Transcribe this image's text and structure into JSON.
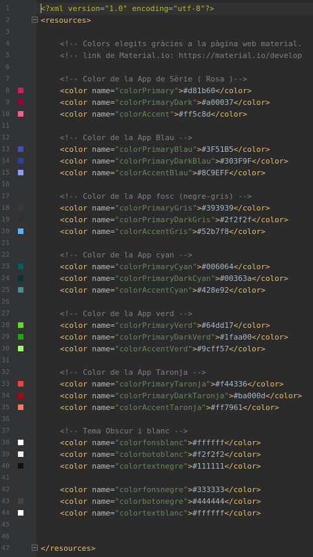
{
  "editor": {
    "lines": [
      {
        "n": "1",
        "kind": "pi",
        "text": "<?xml version=\"1.0\" encoding=\"utf-8\"?>"
      },
      {
        "n": "2",
        "kind": "open",
        "text": "<resources>"
      },
      {
        "n": "3",
        "kind": "blank",
        "text": ""
      },
      {
        "n": "4",
        "kind": "comment",
        "text": "<!-- Colors elegits gràcies a la pàgina web material."
      },
      {
        "n": "5",
        "kind": "comment",
        "text": "<!-- link de Material.io: https://material.io/develop"
      },
      {
        "n": "6",
        "kind": "blank",
        "text": ""
      },
      {
        "n": "7",
        "kind": "comment",
        "text": "<!-- Color de la App de Sèrie ( Rosa )-->"
      },
      {
        "n": "8",
        "kind": "color",
        "name": "colorPrimary",
        "value": "#d81b60",
        "swatch": "#d81b60"
      },
      {
        "n": "9",
        "kind": "color",
        "name": "colorPrimaryDark",
        "value": "#a00037",
        "swatch": "#a00037"
      },
      {
        "n": "10",
        "kind": "color",
        "name": "colorAccent",
        "value": "#ff5c8d",
        "swatch": "#ff5c8d"
      },
      {
        "n": "11",
        "kind": "blank",
        "text": ""
      },
      {
        "n": "12",
        "kind": "comment",
        "text": "<!-- Color de la App Blau -->"
      },
      {
        "n": "13",
        "kind": "color",
        "name": "colorPrimaryBlau",
        "value": "#3F51B5",
        "swatch": "#3F51B5"
      },
      {
        "n": "14",
        "kind": "color",
        "name": "colorPrimaryDarkBlau",
        "value": "#303F9F",
        "swatch": "#303F9F"
      },
      {
        "n": "15",
        "kind": "color",
        "name": "colorAccentBlau",
        "value": "#8C9EFF",
        "swatch": "#8C9EFF"
      },
      {
        "n": "16",
        "kind": "blank",
        "text": ""
      },
      {
        "n": "17",
        "kind": "comment",
        "text": "<!-- Color de la App fosc (negre-gris) -->"
      },
      {
        "n": "18",
        "kind": "color",
        "name": "colorPrimaryGris",
        "value": "#393939",
        "swatch": "#393939"
      },
      {
        "n": "19",
        "kind": "color",
        "name": "colorPrimaryDarkGris",
        "value": "#2f2f2f",
        "swatch": "#2f2f2f"
      },
      {
        "n": "20",
        "kind": "color",
        "name": "colorAccentGris",
        "value": "#52b7f8",
        "swatch": "#52b7f8"
      },
      {
        "n": "21",
        "kind": "blank",
        "text": ""
      },
      {
        "n": "22",
        "kind": "comment",
        "text": "<!-- Color de la App cyan -->"
      },
      {
        "n": "23",
        "kind": "color",
        "name": "colorPrimaryCyan",
        "value": "#006064",
        "swatch": "#006064"
      },
      {
        "n": "24",
        "kind": "color",
        "name": "colorPrimaryDarkCyan",
        "value": "#00363a",
        "swatch": "#00363a"
      },
      {
        "n": "25",
        "kind": "color",
        "name": "colorAccentCyan",
        "value": "#428e92",
        "swatch": "#428e92"
      },
      {
        "n": "26",
        "kind": "blank",
        "text": ""
      },
      {
        "n": "27",
        "kind": "comment",
        "text": "<!-- Color de la App verd -->"
      },
      {
        "n": "28",
        "kind": "color",
        "name": "colorPrimaryVerd",
        "value": "#64dd17",
        "swatch": "#64dd17"
      },
      {
        "n": "29",
        "kind": "color",
        "name": "colorPrimaryDarkVerd",
        "value": "#1faa00",
        "swatch": "#1faa00"
      },
      {
        "n": "30",
        "kind": "color",
        "name": "colorAccentVerd",
        "value": "#9cff57",
        "swatch": "#9cff57"
      },
      {
        "n": "31",
        "kind": "blank",
        "text": ""
      },
      {
        "n": "32",
        "kind": "comment",
        "text": "<!-- Color de la App Taronja -->"
      },
      {
        "n": "33",
        "kind": "color",
        "name": "colorPrimaryTaronja",
        "value": "#f44336",
        "swatch": "#f44336"
      },
      {
        "n": "34",
        "kind": "color",
        "name": "colorPrimaryDarkTaronja",
        "value": "#ba000d",
        "swatch": "#ba000d"
      },
      {
        "n": "35",
        "kind": "color",
        "name": "colorAccentTaronja",
        "value": "#ff7961",
        "swatch": "#ff7961"
      },
      {
        "n": "36",
        "kind": "blank",
        "text": ""
      },
      {
        "n": "37",
        "kind": "comment",
        "text": "<!-- Tema Obscur i blanc -->"
      },
      {
        "n": "38",
        "kind": "color",
        "name": "colorfonsblanc",
        "value": "#ffffff",
        "swatch": "#ffffff"
      },
      {
        "n": "39",
        "kind": "color",
        "name": "colorbotoblanc",
        "value": "#f2f2f2",
        "swatch": "#f2f2f2"
      },
      {
        "n": "40",
        "kind": "color",
        "name": "colortextnegre",
        "value": "#111111",
        "swatch": "#111111"
      },
      {
        "n": "41",
        "kind": "blank",
        "text": ""
      },
      {
        "n": "42",
        "kind": "color",
        "name": "colorfonsnegre",
        "value": "#333333",
        "swatch": "#333333"
      },
      {
        "n": "43",
        "kind": "color",
        "name": "colorbotonegre",
        "value": "#444444",
        "swatch": "#444444"
      },
      {
        "n": "44",
        "kind": "color",
        "name": "colortextblanc",
        "value": "#ffffff",
        "swatch": "#ffffff"
      },
      {
        "n": "45",
        "kind": "blank",
        "text": ""
      },
      {
        "n": "46",
        "kind": "blank",
        "text": ""
      },
      {
        "n": "47",
        "kind": "close",
        "text": "</resources>"
      }
    ],
    "colors": {
      "background": "#2b2b2b",
      "gutter": "#313335",
      "tag": "#e8bf6a",
      "attr": "#bababa",
      "value": "#6a8759",
      "comment": "#808080"
    }
  }
}
